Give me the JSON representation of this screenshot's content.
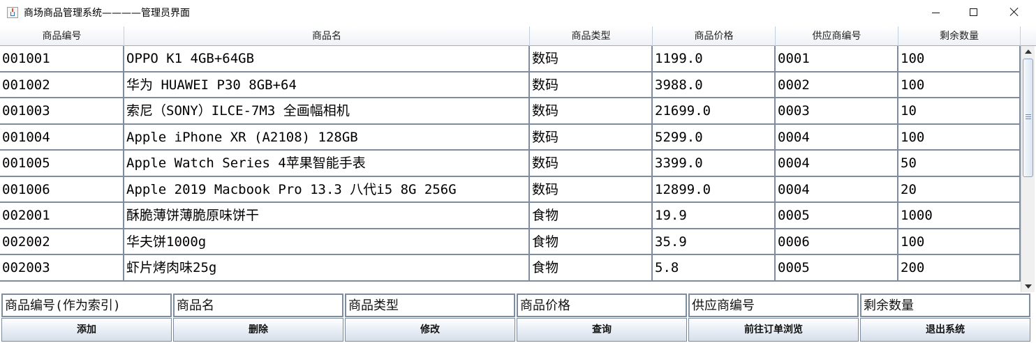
{
  "window": {
    "title": "商场商品管理系统————管理员界面",
    "controls": [
      "minimize-icon",
      "maximize-icon",
      "close-icon"
    ],
    "app_icon": "java-cup-icon"
  },
  "table": {
    "columns": [
      "商品编号",
      "商品名",
      "商品类型",
      "商品价格",
      "供应商编号",
      "剩余数量"
    ],
    "rows": [
      [
        "001001",
        "OPPO K1 4GB+64GB",
        "数码",
        "1199.0",
        "0001",
        "100"
      ],
      [
        "001002",
        "华为 HUAWEI P30 8GB+64",
        "数码",
        "3988.0",
        "0002",
        "100"
      ],
      [
        "001003",
        "索尼（SONY）ILCE-7M3 全画幅相机",
        "数码",
        "21699.0",
        "0003",
        "10"
      ],
      [
        "001004",
        "Apple iPhone XR (A2108) 128GB",
        "数码",
        "5299.0",
        "0004",
        "100"
      ],
      [
        "001005",
        "Apple Watch Series 4苹果智能手表",
        "数码",
        "3399.0",
        "0004",
        "50"
      ],
      [
        "001006",
        "Apple 2019 Macbook Pro 13.3 八代i5 8G 256G",
        "数码",
        "12899.0",
        "0004",
        "20"
      ],
      [
        "002001",
        "酥脆薄饼薄脆原味饼干",
        "食物",
        "19.9",
        "0005",
        "1000"
      ],
      [
        "002002",
        "华夫饼1000g",
        "食物",
        "35.9",
        "0006",
        "100"
      ],
      [
        "002003",
        "虾片烤肉味25g",
        "食物",
        "5.8",
        "0005",
        "200"
      ]
    ]
  },
  "form": {
    "placeholders": [
      "商品编号(作为索引)",
      "商品名",
      "商品类型",
      "商品价格",
      "供应商编号",
      "剩余数量"
    ]
  },
  "buttons": {
    "labels": [
      "添加",
      "删除",
      "修改",
      "查询",
      "前往订单浏览",
      "退出系统"
    ]
  },
  "colors": {
    "grid_line": "#7d8c9e",
    "header_bg": "#eef1f6",
    "button_bg": "#e7edf5"
  }
}
